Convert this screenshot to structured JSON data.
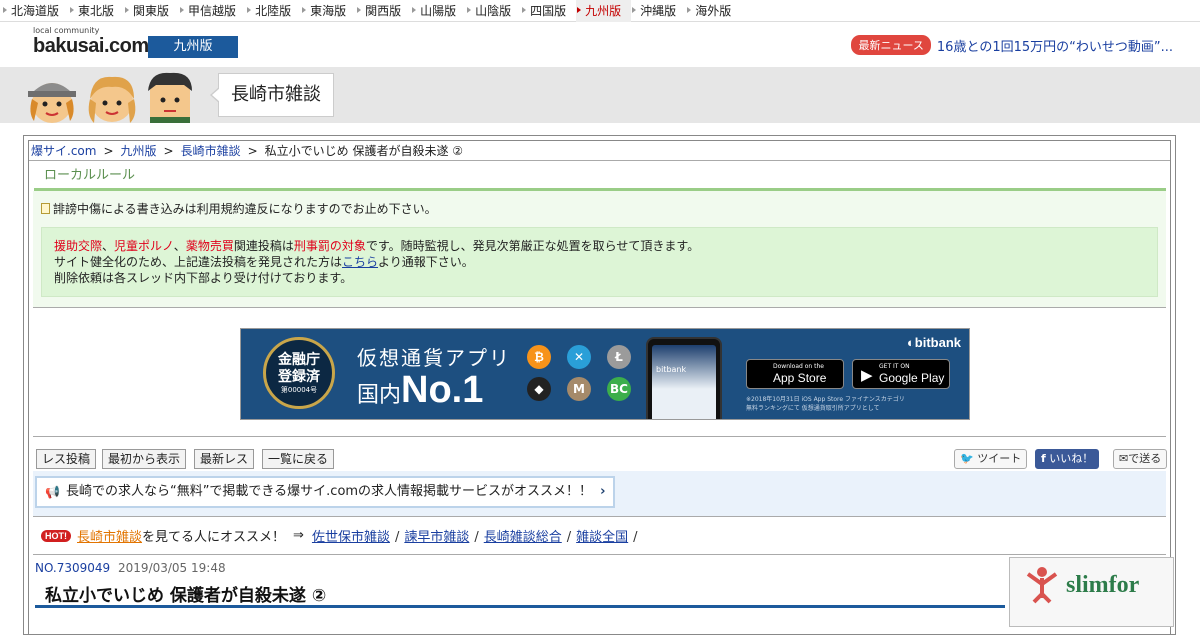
{
  "regions": [
    {
      "label": "北海道版",
      "active": false
    },
    {
      "label": "東北版",
      "active": false
    },
    {
      "label": "関東版",
      "active": false
    },
    {
      "label": "甲信越版",
      "active": false
    },
    {
      "label": "北陸版",
      "active": false
    },
    {
      "label": "東海版",
      "active": false
    },
    {
      "label": "関西版",
      "active": false
    },
    {
      "label": "山陽版",
      "active": false
    },
    {
      "label": "山陰版",
      "active": false
    },
    {
      "label": "四国版",
      "active": false
    },
    {
      "label": "九州版",
      "active": true
    },
    {
      "label": "沖縄版",
      "active": false
    },
    {
      "label": "海外版",
      "active": false
    }
  ],
  "header": {
    "logo_small": "local community",
    "logo_main": "bakusai.com",
    "edition": "九州版",
    "news_label": "最新ニュース",
    "news_text": "16歳との1回15万円の“わいせつ動画”..."
  },
  "board": {
    "title": "長崎市雑談"
  },
  "breadcrumb": {
    "home": "爆サイ.com",
    "region": "九州版",
    "board": "長崎市雑談",
    "current": "私立小でいじめ 保護者が自殺未遂 ②"
  },
  "local_rules": {
    "title": "ローカルルール",
    "line1": "誹謗中傷による書き込みは利用規約違反になりますのでお止め下さい。",
    "box_red1": "援助交際",
    "box_sep1": "、",
    "box_red2": "児童ポルノ",
    "box_sep2": "、",
    "box_red3": "薬物売買",
    "box_mid": "関連投稿は",
    "box_red4": "刑事罰の対象",
    "box_tail": "です。随時監視し、発見次第厳正な処置を取らせて頂きます。",
    "box_line2a": "サイト健全化のため、上記違法投稿を発見された方は",
    "box_link": "こちら",
    "box_line2b": "より通報下さい。",
    "box_line3": "削除依頼は各スレッド内下部より受け付けております。"
  },
  "ad": {
    "seal_line1": "金融庁",
    "seal_line2": "登録済",
    "seal_small": "第00004号",
    "title": "仮想通貨アプリ",
    "sub_prefix": "国内",
    "sub_big": "No.1",
    "brand": "bitbank",
    "app_store_small": "Download on the",
    "app_store": "App Store",
    "google_small": "GET IT ON",
    "google": "Google Play",
    "note1": "※2018年10月31日 iOS App Store ファイナンスカテゴリ",
    "note2": "無料ランキングにて 仮想通貨取引所アプリとして",
    "coins": [
      "₿",
      "✕",
      "Ł",
      "◆",
      "M",
      "BC"
    ],
    "coin_colors": [
      "#f7931a",
      "#2a9fd8",
      "#9b9b9b",
      "#222222",
      "#a58a6a",
      "#3cae4b"
    ]
  },
  "actions": {
    "reply": "レス投稿",
    "from_start": "最初から表示",
    "latest": "最新レス",
    "back": "一覧に戻る",
    "tweet": "ツイート",
    "like": "いいね！",
    "send": "で送る"
  },
  "promo": {
    "text": "長崎での求人なら“無料”で掲載できる爆サイ.comの求人情報掲載サービスがオススメ！！"
  },
  "related": {
    "hot": "HOT!",
    "board": "長崎市雑談",
    "text": "を見てる人にオススメ！",
    "arrow": "⇒",
    "links": [
      "佐世保市雑談",
      "諫早市雑談",
      "長崎雑談総合",
      "雑談全国"
    ]
  },
  "post": {
    "number": "NO.7309049",
    "date": "2019/03/05 19:48",
    "title": "私立小でいじめ 保護者が自殺未遂 ②"
  },
  "side_ad": {
    "brand": "slimfor"
  }
}
